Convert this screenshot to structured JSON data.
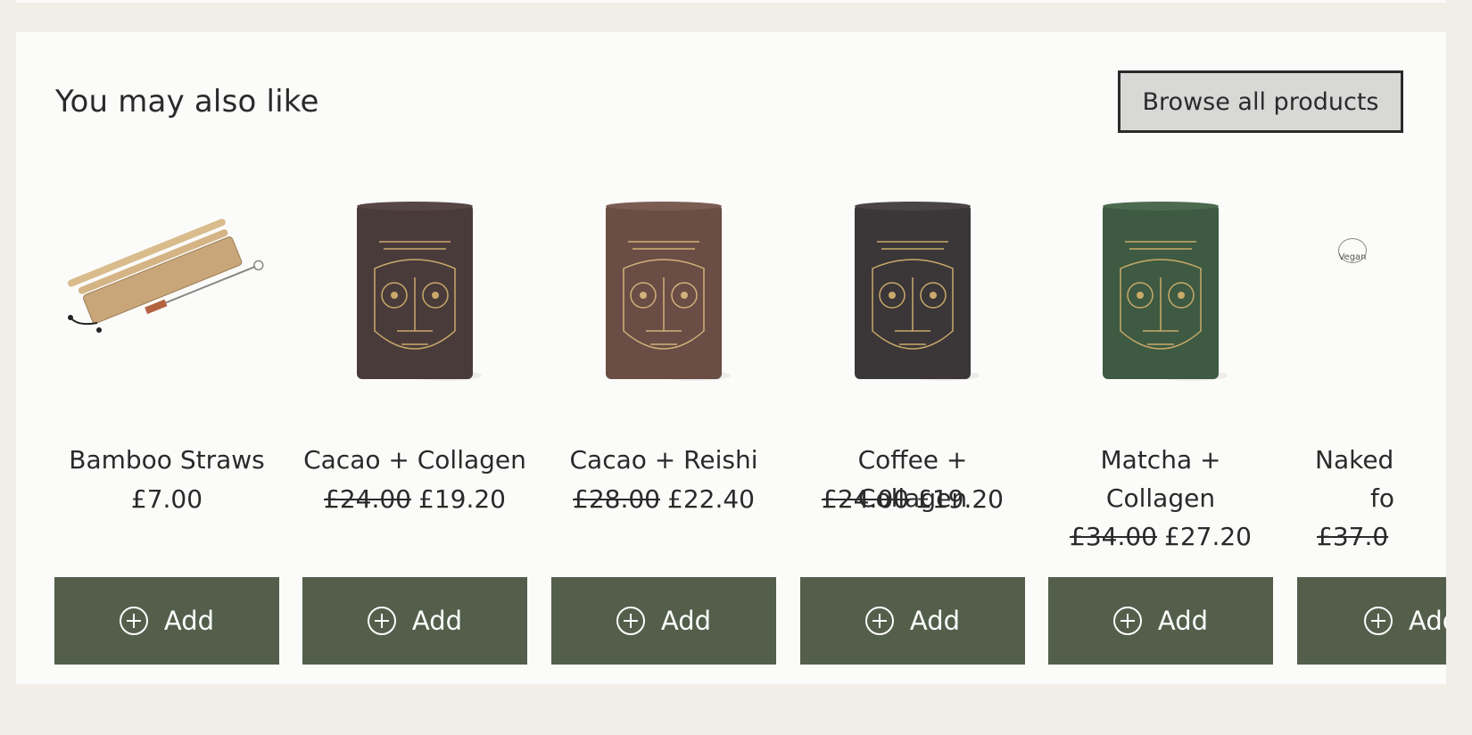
{
  "section": {
    "title": "You may also like",
    "browse_label": "Browse all products"
  },
  "products": [
    {
      "name": "Bamboo Straws",
      "price": "£7.00",
      "old_price": "",
      "add_label": "Add",
      "image": "bamboo-straws"
    },
    {
      "name": "Cacao + Collagen",
      "price": "£19.20",
      "old_price": "£24.00",
      "add_label": "Add",
      "image": "tin-cacao-collagen",
      "color": "#4a3b3b"
    },
    {
      "name": "Cacao + Reishi",
      "price": "£22.40",
      "old_price": "£28.00",
      "add_label": "Add",
      "image": "tin-cacao-reishi",
      "color": "#6a4d45"
    },
    {
      "name": "Coffee + Collagen",
      "price": "£19.20",
      "old_price": "£24.00",
      "add_label": "Add",
      "image": "tin-coffee-collagen",
      "color": "#3b3638"
    },
    {
      "name_line1": "Matcha +",
      "name_line2": "Collagen",
      "price": "£27.20",
      "old_price": "£34.00",
      "add_label": "Add",
      "image": "tin-matcha-collagen",
      "color": "#3e5a42"
    },
    {
      "name_line1": "Naked",
      "name_line2": "fo",
      "price_partial": "£37.0",
      "add_label": "Add",
      "image": "bottle-partial",
      "badge": "Vegan"
    }
  ]
}
